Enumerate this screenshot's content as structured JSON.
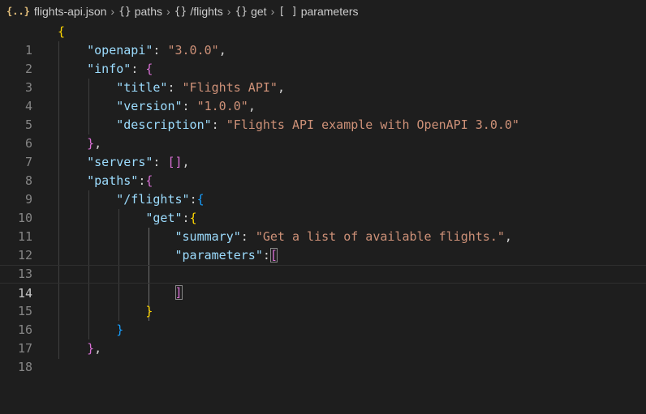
{
  "breadcrumb": {
    "file_icon": "json-file-icon",
    "file_icon_glyph": "{..}",
    "file_name": "flights-api.json",
    "object_icon_glyph": "{}",
    "array_icon_glyph": "[ ]",
    "items": [
      {
        "label": "paths",
        "icon": "object-icon"
      },
      {
        "label": "/flights",
        "icon": "object-icon"
      },
      {
        "label": "get",
        "icon": "object-icon"
      },
      {
        "label": "parameters",
        "icon": "array-icon"
      }
    ]
  },
  "editor": {
    "current_line": 14,
    "lines": [
      {
        "n": "1"
      },
      {
        "n": "2",
        "key": "\"openapi\"",
        "val": "\"3.0.0\""
      },
      {
        "n": "3",
        "key": "\"info\""
      },
      {
        "n": "4",
        "key": "\"title\"",
        "val": "\"Flights API\""
      },
      {
        "n": "5",
        "key": "\"version\"",
        "val": "\"1.0.0\""
      },
      {
        "n": "6",
        "key": "\"description\"",
        "val": "\"Flights API example with OpenAPI 3.0.0\""
      },
      {
        "n": "7"
      },
      {
        "n": "8",
        "key": "\"servers\""
      },
      {
        "n": "9",
        "key": "\"paths\""
      },
      {
        "n": "10",
        "key": "\"/flights\""
      },
      {
        "n": "11",
        "key": "\"get\""
      },
      {
        "n": "12",
        "key": "\"summary\"",
        "val": "\"Get a list of available flights.\""
      },
      {
        "n": "13",
        "key": "\"parameters\""
      },
      {
        "n": "14"
      },
      {
        "n": "15"
      },
      {
        "n": "16"
      },
      {
        "n": "17"
      },
      {
        "n": "18"
      }
    ]
  },
  "colors": {
    "background": "#1e1e1e",
    "key": "#9cdcfe",
    "string": "#ce9178",
    "bracket_level1": "#ffd700",
    "bracket_level2": "#da70d6",
    "bracket_level3": "#179fff"
  }
}
